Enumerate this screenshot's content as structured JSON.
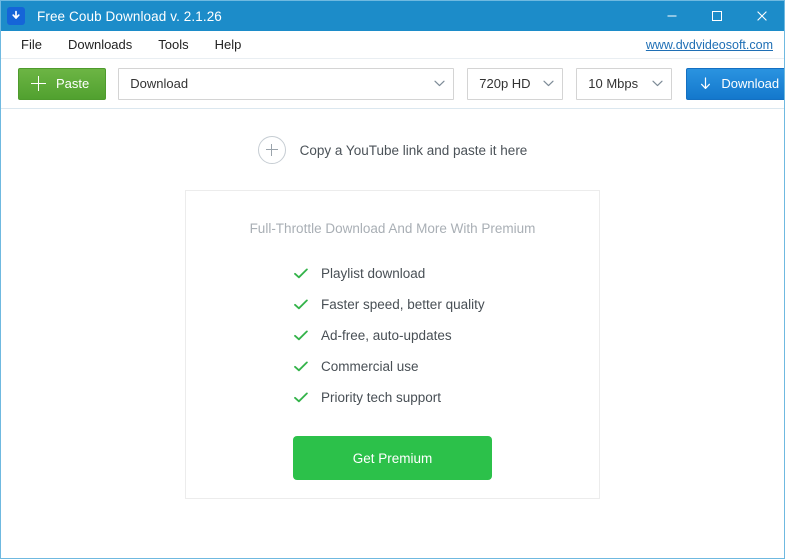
{
  "window": {
    "title": "Free Coub Download v. 2.1.26",
    "app_icon": "download-arrow-icon",
    "accent_color": "#1c8cc9",
    "controls": {
      "minimize": "minimize-icon",
      "maximize": "maximize-icon",
      "close": "close-icon"
    }
  },
  "menubar": {
    "items": [
      {
        "label": "File"
      },
      {
        "label": "Downloads"
      },
      {
        "label": "Tools"
      },
      {
        "label": "Help"
      }
    ],
    "site_link": "www.dvdvideosoft.com"
  },
  "toolbar": {
    "paste_label": "Paste",
    "paste_icon": "plus-icon",
    "paste_color": "#5aa834",
    "url_combo": {
      "value": "Download",
      "placeholder": "Download"
    },
    "quality_combo": {
      "value": "720p HD",
      "options": [
        "720p HD"
      ]
    },
    "speed_combo": {
      "value": "10 Mbps",
      "options": [
        "10 Mbps"
      ]
    },
    "download_label": "Download",
    "download_icon": "down-arrow-icon",
    "download_color": "#1f82d6"
  },
  "content": {
    "drop_hint": {
      "icon": "circle-plus-icon",
      "text": "Copy a YouTube link and paste it here"
    },
    "premium": {
      "title": "Full-Throttle Download And More With Premium",
      "check_icon": "check-icon",
      "check_color": "#34b34a",
      "features": [
        {
          "label": "Playlist download"
        },
        {
          "label": "Faster speed, better quality"
        },
        {
          "label": "Ad-free, auto-updates"
        },
        {
          "label": "Commercial use"
        },
        {
          "label": "Priority tech support"
        }
      ],
      "cta_label": "Get Premium",
      "cta_color": "#2cc14a"
    }
  }
}
